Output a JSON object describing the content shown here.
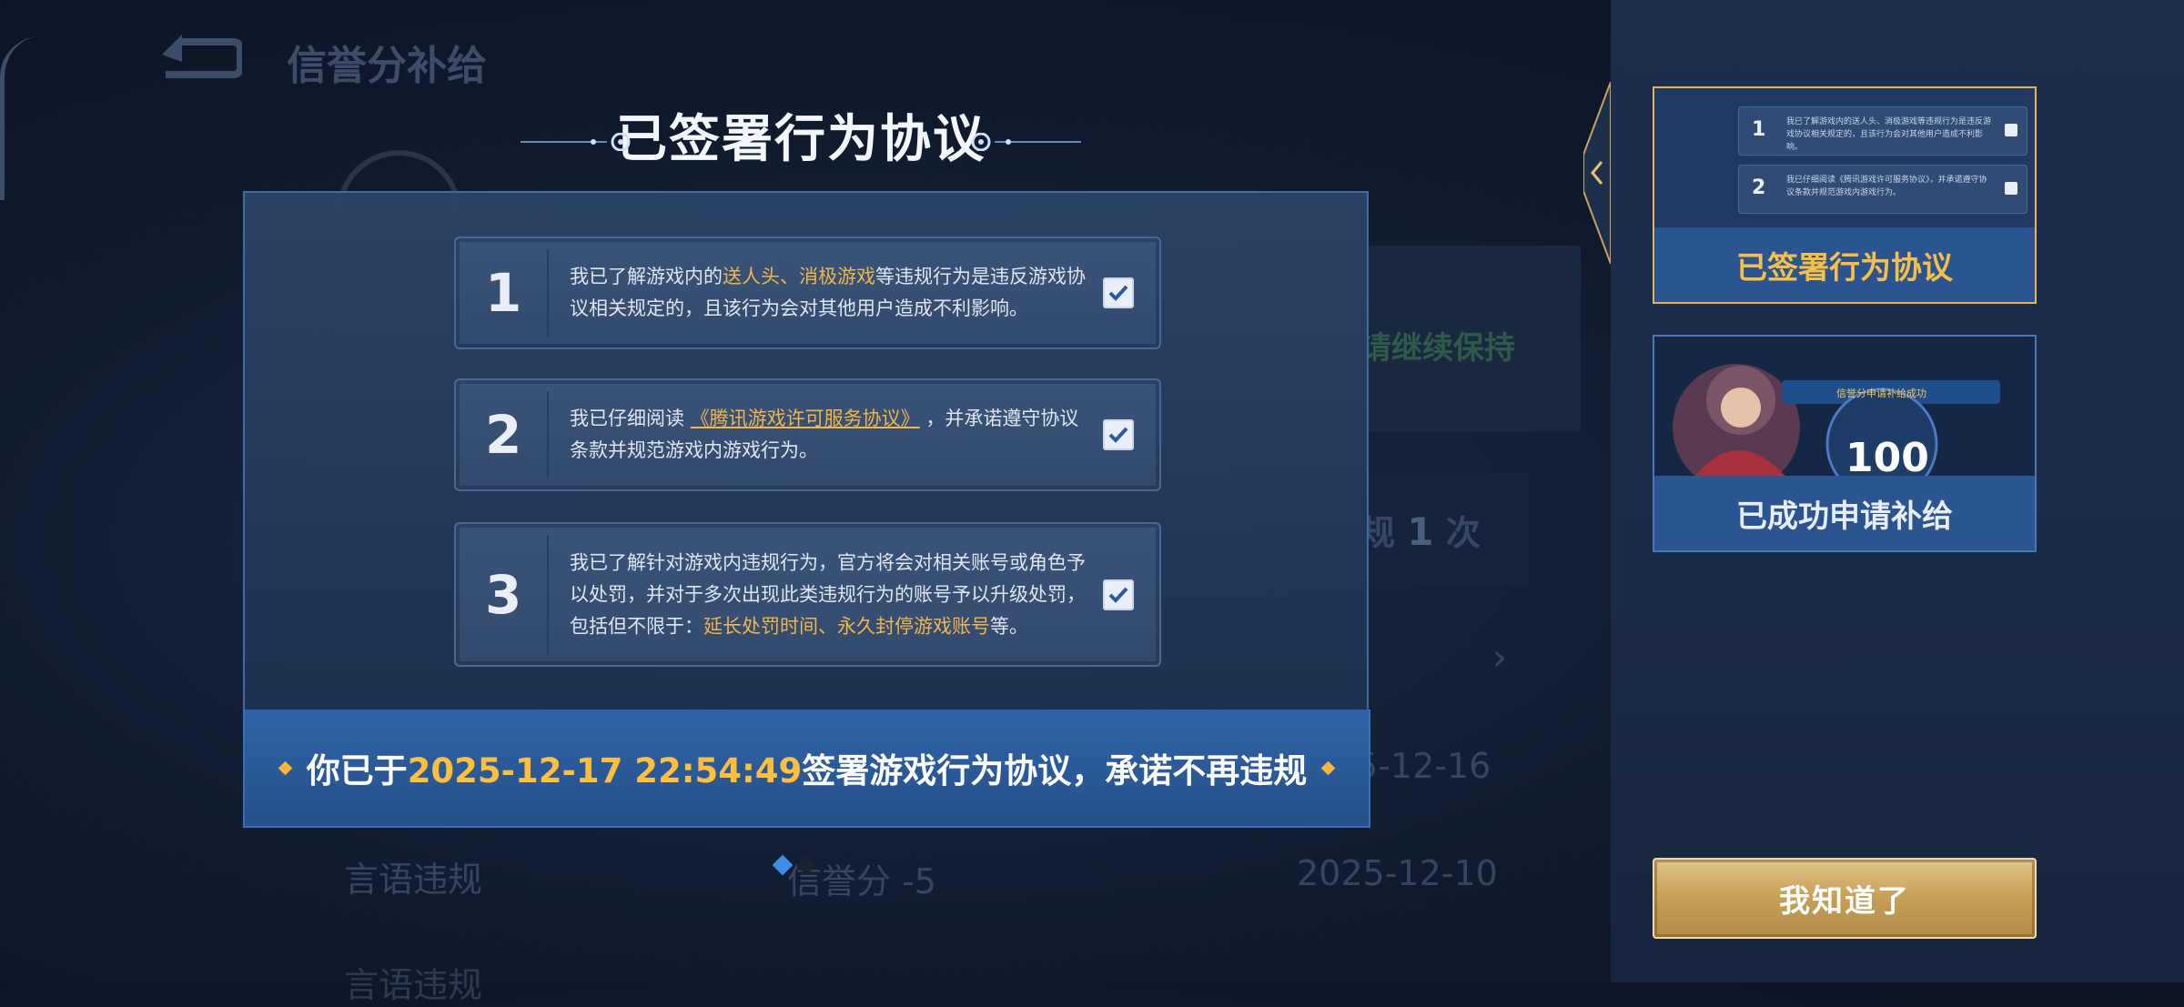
{
  "background": {
    "title": "信誉分补给",
    "keep_text": "请继续保持",
    "violation_count_prefix": "规",
    "violation_count": "1",
    "violation_count_suffix": "次",
    "date_1": "5-12-16",
    "row": {
      "label": "言语违规",
      "score": "信誉分 -5",
      "date": "2025-12-10"
    },
    "row2_label": "言语违规"
  },
  "modal": {
    "title": "已签署行为协议",
    "items": [
      {
        "num": "1",
        "text_a": "我已了解游戏内的",
        "highlight": "送人头、消极游戏",
        "text_b": "等违规行为是违反游戏协议相关规定的，且该行为会对其他用户造成不利影响。",
        "checked": true
      },
      {
        "num": "2",
        "text_a": "我已仔细阅读",
        "link": "《腾讯游戏许可服务协议》",
        "text_b": "，并承诺遵守协议条款并规范游戏内游戏行为。",
        "checked": true
      },
      {
        "num": "3",
        "text_a": "我已了解针对游戏内违规行为，官方将会对相关账号或角色予以处罚，并对于多次出现此类违规行为的账号予以升级处罚，包括但不限于：",
        "highlight": "延长处罚时间、永久封停游戏账号",
        "text_b": "等。",
        "checked": true
      }
    ],
    "footer": {
      "prefix": "你已于",
      "timestamp": "2025-12-17 22:54:49",
      "suffix": "签署游戏行为协议，承诺不再违规"
    }
  },
  "right_panel": {
    "tabs": [
      {
        "label": "已签署行为协议",
        "active": true
      },
      {
        "label": "已成功申请补给",
        "active": false
      }
    ],
    "mini_rows": [
      {
        "num": "1",
        "text": "我已了解游戏内的送人头、消极游戏等违规行为是违反游戏协议相关规定的，且该行为会对其他用户造成不利影响。"
      },
      {
        "num": "2",
        "text": "我已仔细阅读《腾讯游戏许可服务协议》，并承诺遵守协议条款并规范游戏内游戏行为。"
      }
    ],
    "thumb2_banner": "信誉分申请补给成功",
    "thumb2_score": "100",
    "ok_button": "我知道了"
  },
  "colors": {
    "accent_gold": "#f1b54a",
    "timestamp_gold": "#ffbf3c",
    "panel_blue": "#2f63a6",
    "button_gold": "#c79f55"
  }
}
